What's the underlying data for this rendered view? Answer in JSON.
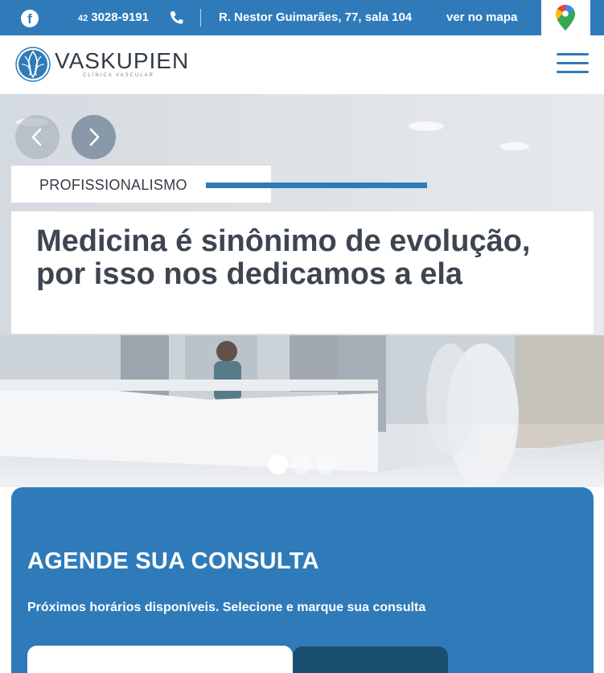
{
  "topbar": {
    "facebook_icon": "facebook-icon",
    "phone_ddd": "42",
    "phone_number": "3028-9191",
    "phone_icon": "phone-icon",
    "address": "R. Nestor Guimarães, 77, sala 104",
    "map_link": "ver no mapa",
    "map_icon": "google-maps-pin-icon"
  },
  "header": {
    "logo_name": "VASKUPIEN",
    "logo_subtitle": "CLÍNICA VASCULAR",
    "menu_icon": "hamburger-menu-icon"
  },
  "hero": {
    "prev_icon": "chevron-left-icon",
    "next_icon": "chevron-right-icon",
    "tag": "PROFISSIONALISMO",
    "headline": "Medicina é sinônimo de evolução, por isso nos dedicamos a ela",
    "slides_total": 3,
    "active_slide": 1
  },
  "booking": {
    "title": "AGENDE SUA CONSULTA",
    "subtitle": "Próximos horários disponíveis. Selecione e marque sua consulta"
  },
  "colors": {
    "brand_blue": "#2f7bba",
    "dark_blue": "#1b4f72",
    "text_dark": "#3d4650",
    "white": "#ffffff"
  }
}
